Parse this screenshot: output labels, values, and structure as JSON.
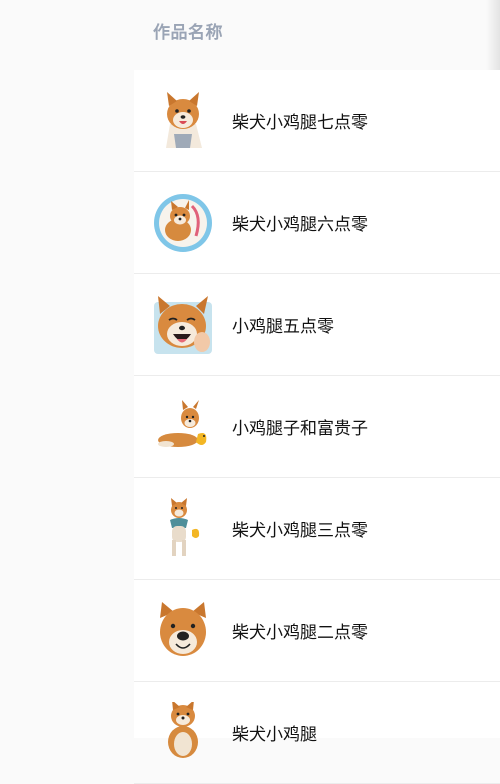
{
  "header": {
    "column_title": "作品名称"
  },
  "works": [
    {
      "title": "柴犬小鸡腿七点零",
      "thumbnail": "shiba-smiling-sticker"
    },
    {
      "title": "柴犬小鸡腿六点零",
      "thumbnail": "shiba-round-badge-sticker"
    },
    {
      "title": "小鸡腿五点零",
      "thumbnail": "shiba-laughing-sticker"
    },
    {
      "title": "小鸡腿子和富贵子",
      "thumbnail": "shiba-lying-with-chick-sticker"
    },
    {
      "title": "柴犬小鸡腿三点零",
      "thumbnail": "shiba-standing-with-chick-sticker"
    },
    {
      "title": "柴犬小鸡腿二点零",
      "thumbnail": "shiba-face-closeup-sticker"
    },
    {
      "title": "柴犬小鸡腿",
      "thumbnail": "shiba-sitting-sticker"
    }
  ]
}
